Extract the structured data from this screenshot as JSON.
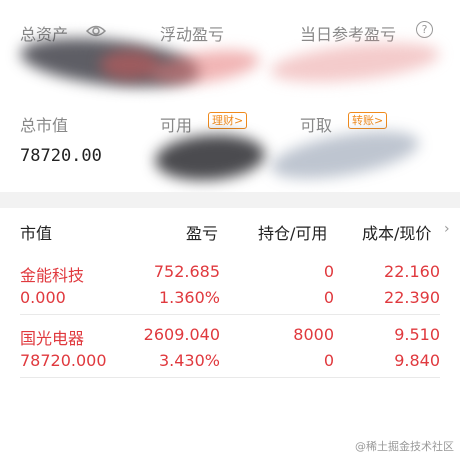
{
  "summary": {
    "total_assets_label": "总资产",
    "floating_pl_label": "浮动盈亏",
    "today_ref_pl_label": "当日参考盈亏",
    "market_value_label": "总市值",
    "market_value": "78720.00",
    "available_label": "可用",
    "wealth_badge": "理财>",
    "withdrawable_label": "可取",
    "transfer_badge": "转账>"
  },
  "table": {
    "headers": {
      "market_value": "市值",
      "pl": "盈亏",
      "position": "持仓/可用",
      "cost_price": "成本/现价"
    },
    "rows": [
      {
        "name": "金能科技",
        "market_value": "0.000",
        "pl": "752.685",
        "pl_pct": "1.360%",
        "position": "0",
        "available": "0",
        "cost": "22.160",
        "price": "22.390"
      },
      {
        "name": "国光电器",
        "market_value": "78720.000",
        "pl": "2609.040",
        "pl_pct": "3.430%",
        "position": "8000",
        "available": "0",
        "cost": "9.510",
        "price": "9.840"
      }
    ]
  },
  "watermark": "@稀土掘金技术社区",
  "colors": {
    "up_red": "#e0393e",
    "badge_orange": "#f08a1c"
  }
}
